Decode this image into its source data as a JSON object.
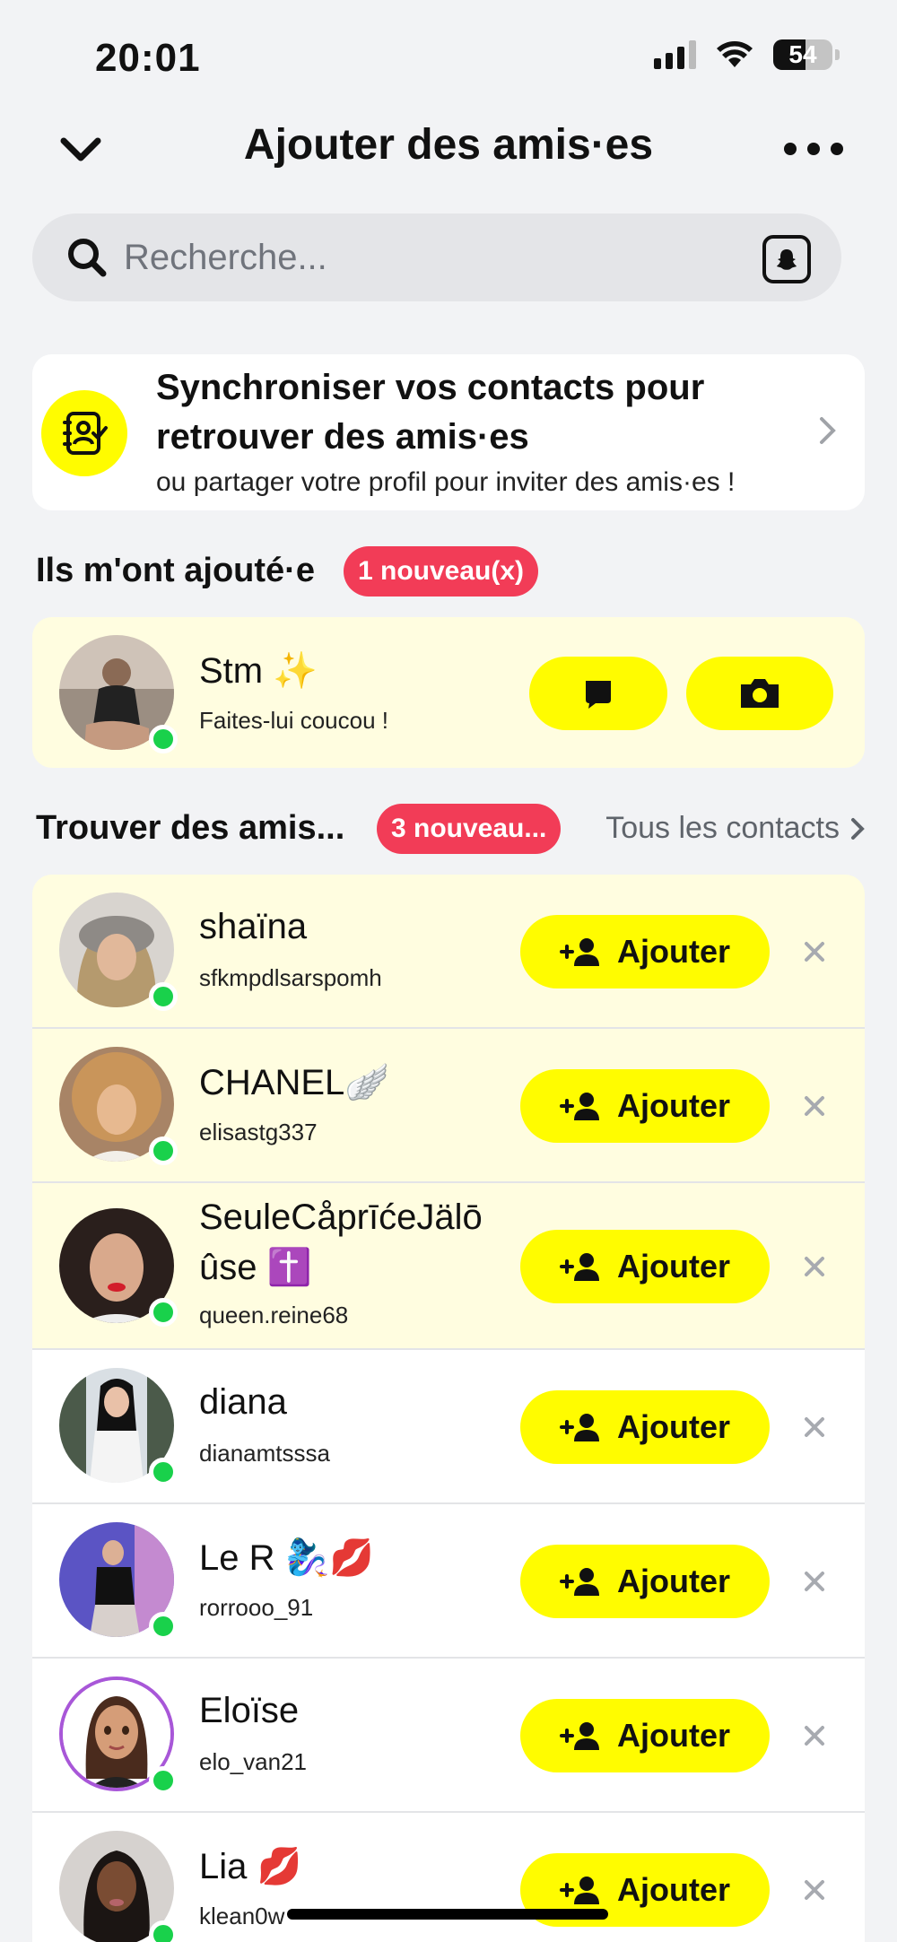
{
  "status_bar": {
    "time": "20:01",
    "battery": "54",
    "battery_level_percent": 54
  },
  "header": {
    "title": "Ajouter des amis·es",
    "back_icon": "chevron-down-icon",
    "more_icon": "more-dots-icon"
  },
  "search": {
    "placeholder": "Recherche...",
    "icon": "search-icon",
    "snapcode_icon": "snapcode-icon"
  },
  "sync_card": {
    "title": "Synchroniser vos contacts pour retrouver des amis·es",
    "subtitle": "ou partager votre profil pour inviter des amis·es !",
    "icon": "contacts-sync-icon"
  },
  "added_me": {
    "title": "Ils m'ont ajouté·e",
    "badge": "1 nouveau(x)",
    "person": {
      "name": "Stm ✨",
      "subtitle": "Faites-lui coucou !",
      "online": true,
      "chat_icon": "chat-icon",
      "camera_icon": "camera-icon"
    }
  },
  "find_friends": {
    "title": "Trouver des amis...",
    "badge": "3 nouveau...",
    "see_all": "Tous les contacts",
    "add_label": "Ajouter",
    "people": [
      {
        "name": "shaïna",
        "username": "sfkmpdlsarspomh",
        "online": true,
        "highlighted": true
      },
      {
        "name": "CHANEL🪽",
        "username": "elisastg337",
        "online": true,
        "highlighted": true
      },
      {
        "name_line1": "SeuleCåprīćeJälō",
        "name_line2": "ûse ✝️",
        "username": "queen.reine68",
        "online": true,
        "highlighted": true
      },
      {
        "name": "diana",
        "username": "dianamtsssa",
        "online": true,
        "highlighted": false
      },
      {
        "name": "Le R 🧞‍♀️💋",
        "username": "rorrooo_91",
        "online": true,
        "highlighted": false
      },
      {
        "name": "Eloïse",
        "username": "elo_van21",
        "online": true,
        "highlighted": false
      },
      {
        "name": "Lia 💋",
        "username": "klean0w",
        "online": true,
        "highlighted": false
      }
    ]
  },
  "colors": {
    "accent_yellow": "#FFFC00",
    "badge_red": "#F23C57",
    "online_green": "#19D14B",
    "highlight_bg": "#FFFDE0"
  }
}
